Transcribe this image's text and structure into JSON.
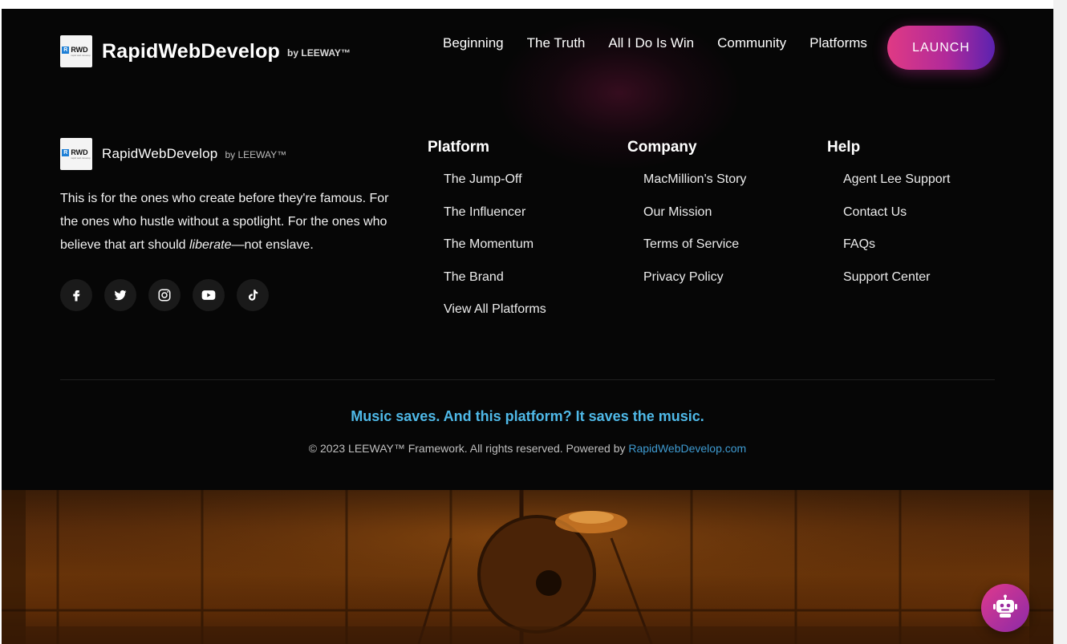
{
  "header": {
    "brand_name": "RapidWebDevelop",
    "brand_by": "by LEEWAY™",
    "logo_text": "RWD",
    "nav": [
      "Beginning",
      "The Truth",
      "All I Do Is Win",
      "Community",
      "Platforms"
    ],
    "launch_label": "LAUNCH"
  },
  "footer": {
    "brand_name": "RapidWebDevelop",
    "brand_by": "by LEEWAY™",
    "tagline_before": "This is for the ones who create before they're famous. For the ones who hustle without a spotlight. For the ones who believe that art should ",
    "tagline_em": "liberate",
    "tagline_after": "—not enslave.",
    "socials": [
      "facebook-icon",
      "twitter-icon",
      "instagram-icon",
      "youtube-icon",
      "tiktok-icon"
    ],
    "columns": [
      {
        "title": "Platform",
        "links": [
          "The Jump-Off",
          "The Influencer",
          "The Momentum",
          "The Brand",
          "View All Platforms"
        ]
      },
      {
        "title": "Company",
        "links": [
          "MacMillion's Story",
          "Our Mission",
          "Terms of Service",
          "Privacy Policy"
        ]
      },
      {
        "title": "Help",
        "links": [
          "Agent Lee Support",
          "Contact Us",
          "FAQs",
          "Support Center"
        ]
      }
    ],
    "slogan": "Music saves. And this platform? It saves the music.",
    "copyright_text": "© 2023 LEEWAY™ Framework. All rights reserved. Powered by ",
    "copyright_link": "RapidWebDevelop.com"
  },
  "chatbot": {
    "icon": "robot-icon"
  },
  "colors": {
    "accent_pink": "#e03a84",
    "accent_purple": "#5b22b0",
    "slogan_blue": "#4fb9e8",
    "link_blue": "#3e9ad0",
    "background": "#060606"
  }
}
